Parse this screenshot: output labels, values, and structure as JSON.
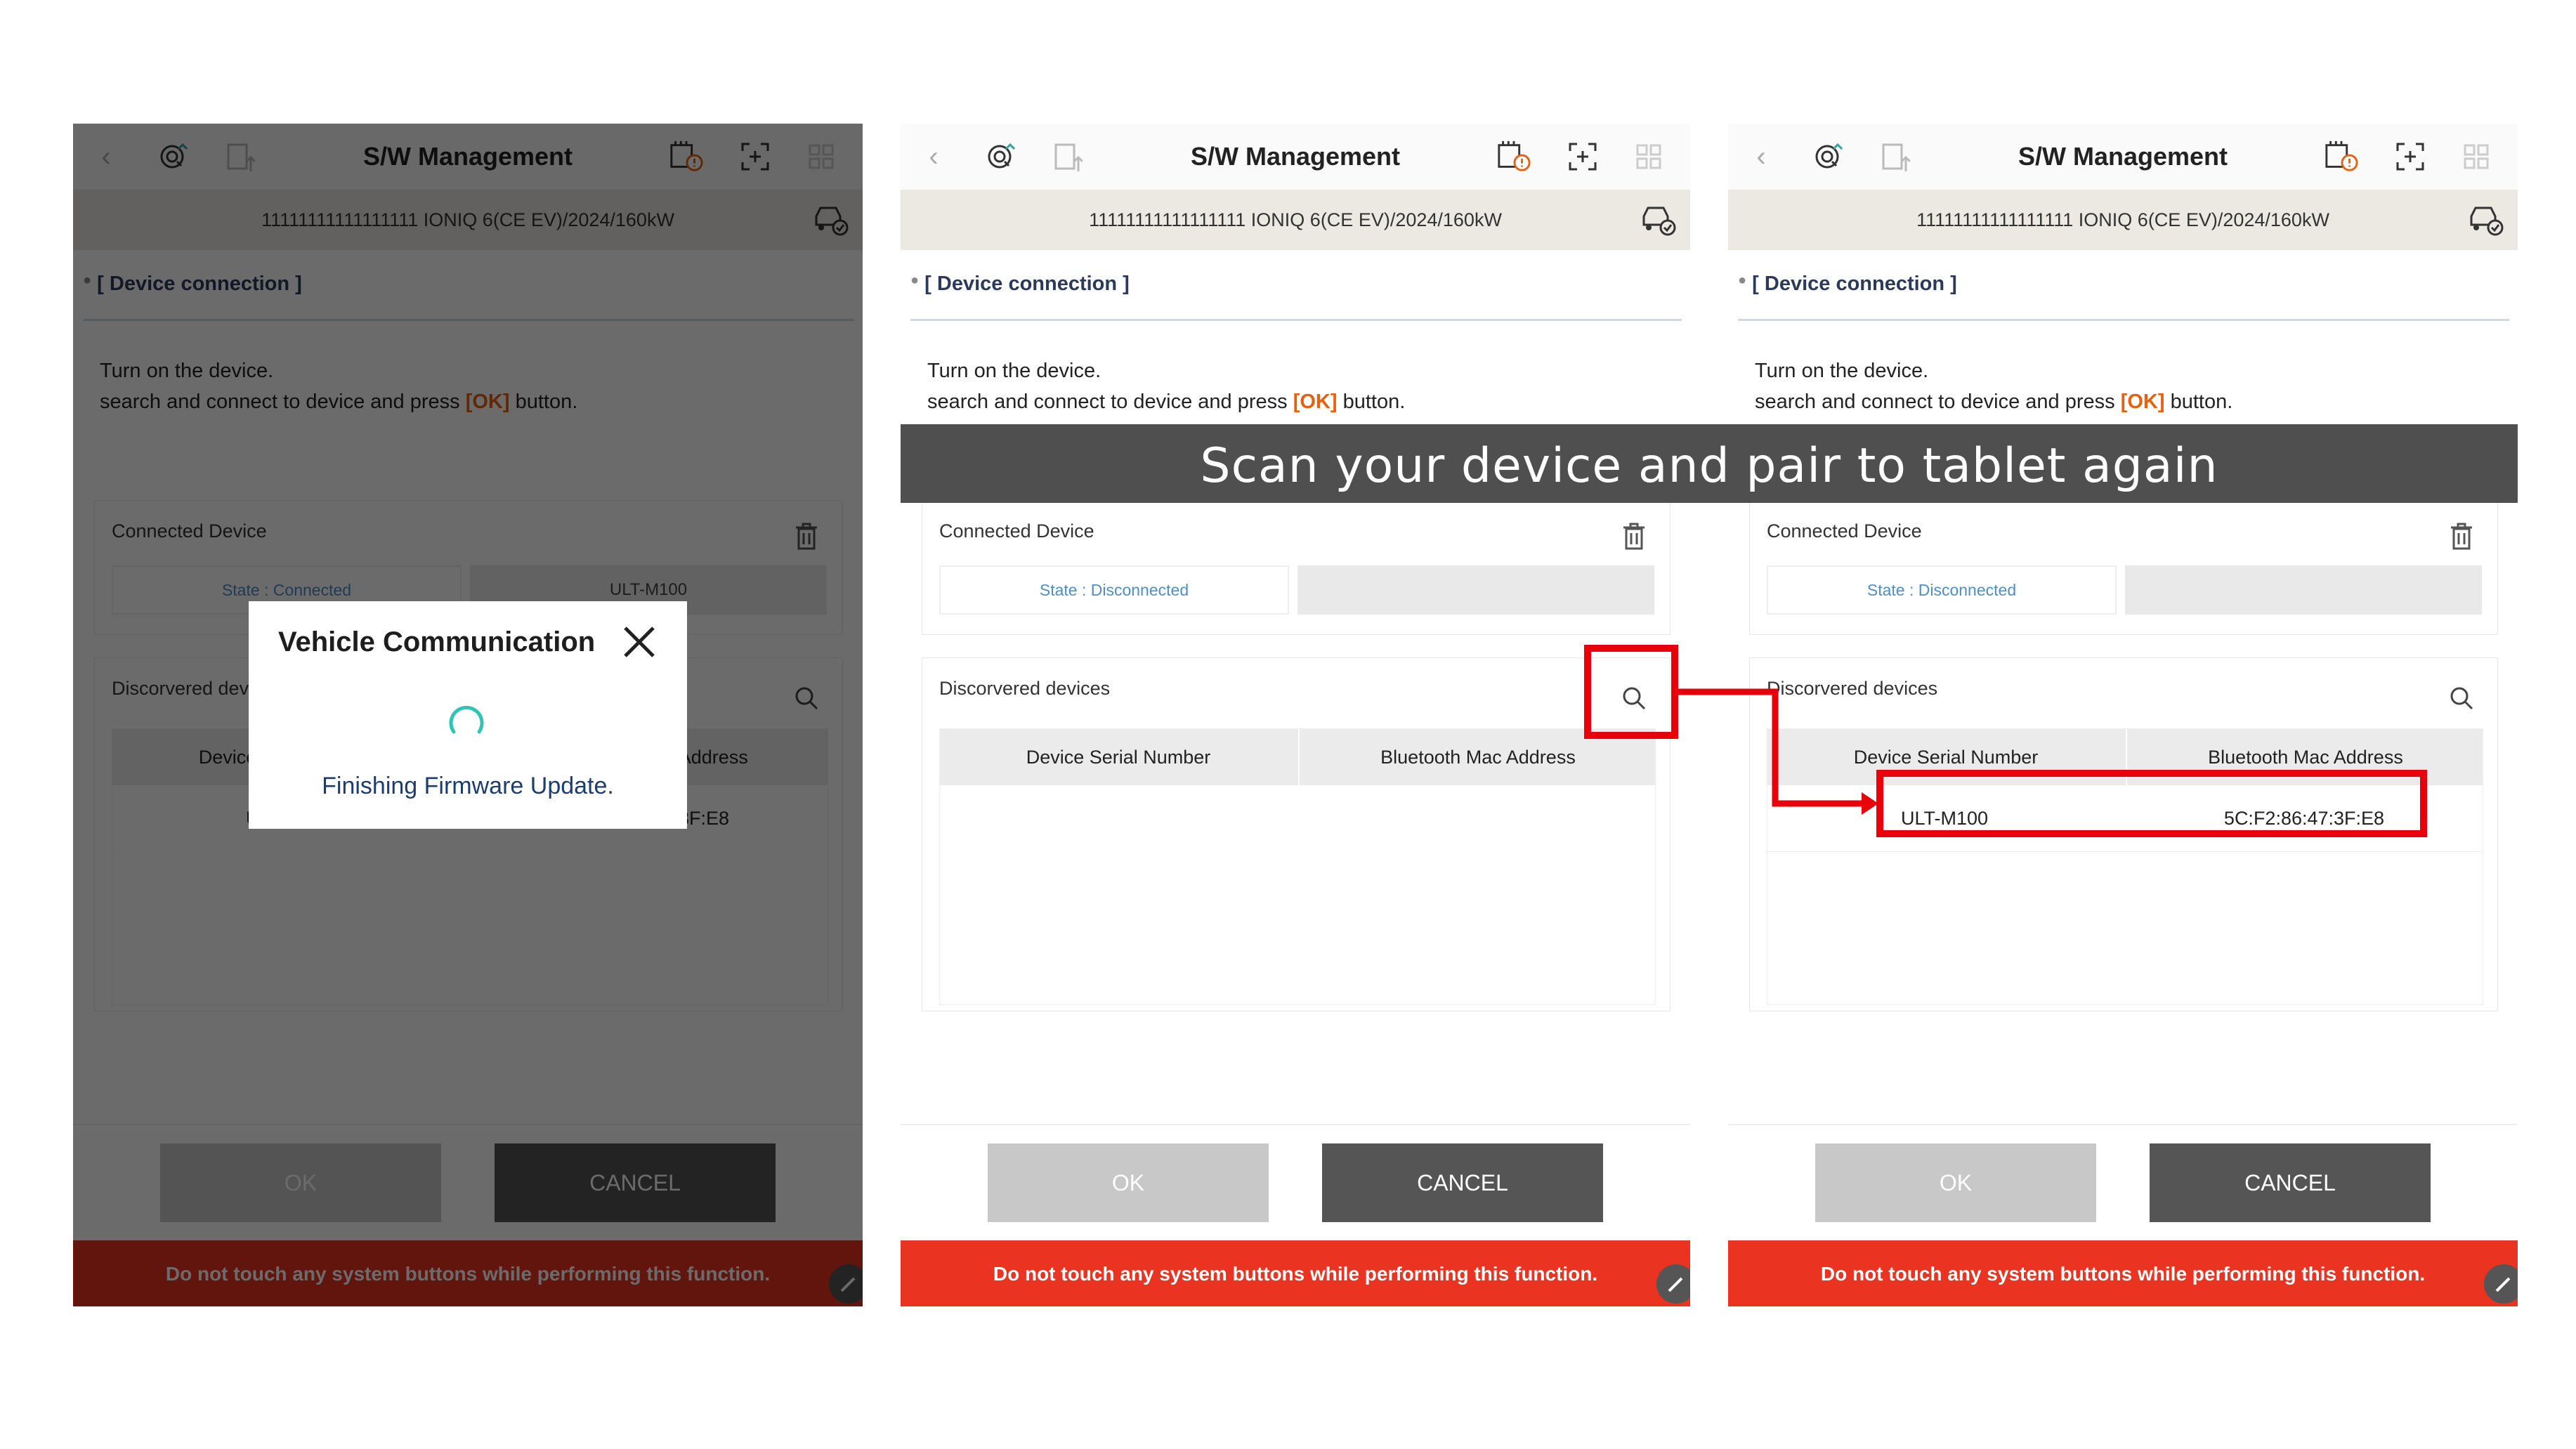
{
  "panels": [
    {
      "title": "S/W Management",
      "vehicle": "11111111111111111  IONIQ 6(CE EV)/2024/160kW",
      "section": "[ Device connection ]",
      "instructions": {
        "line1": "Turn on the device.",
        "line2_pre": "search and connect to device and press ",
        "line2_ok": "[OK]",
        "line2_post": " button."
      },
      "connected": {
        "label": "Connected Device",
        "state": "State : Connected",
        "device": "ULT-M100"
      },
      "discovered": {
        "label": "Discorvered devices",
        "columns": [
          "Device Serial Number",
          "Bluetooth Mac Address"
        ],
        "rows": [
          {
            "serial": "ULT-M100",
            "mac": "5C:F2:86:47:3F:E8"
          }
        ]
      },
      "buttons": {
        "ok": "OK",
        "cancel": "CANCEL"
      },
      "warning": "Do not touch any system buttons while performing this function.",
      "dialog": {
        "title": "Vehicle Communication",
        "message": "Finishing Firmware Update."
      }
    },
    {
      "title": "S/W Management",
      "vehicle": "11111111111111111  IONIQ 6(CE EV)/2024/160kW",
      "section": "[ Device connection ]",
      "instructions": {
        "line1": "Turn on the device.",
        "line2_pre": "search and connect to device and press ",
        "line2_ok": "[OK]",
        "line2_post": " button."
      },
      "connected": {
        "label": "Connected Device",
        "state": "State : Disconnected",
        "device": ""
      },
      "discovered": {
        "label": "Discorvered devices",
        "columns": [
          "Device Serial Number",
          "Bluetooth Mac Address"
        ],
        "rows": []
      },
      "buttons": {
        "ok": "OK",
        "cancel": "CANCEL"
      },
      "warning": "Do not touch any system buttons while performing this function."
    },
    {
      "title": "S/W Management",
      "vehicle": "11111111111111111  IONIQ 6(CE EV)/2024/160kW",
      "section": "[ Device connection ]",
      "instructions": {
        "line1": "Turn on the device.",
        "line2_pre": "search and connect to device and press ",
        "line2_ok": "[OK]",
        "line2_post": " button."
      },
      "connected": {
        "label": "Connected Device",
        "state": "State : Disconnected",
        "device": ""
      },
      "discovered": {
        "label": "Discorvered devices",
        "columns": [
          "Device Serial Number",
          "Bluetooth Mac Address"
        ],
        "rows": [
          {
            "serial": "ULT-M100",
            "mac": "5C:F2:86:47:3F:E8"
          }
        ]
      },
      "buttons": {
        "ok": "OK",
        "cancel": "CANCEL"
      },
      "warning": "Do not touch any system buttons while performing this function."
    }
  ],
  "banner": "Scan your device and pair to tablet again",
  "colors": {
    "warning_bar": "#ea3320",
    "highlight": "#e8000b",
    "ok_bracket": "#e8600c",
    "state_text": "#4d8fc8",
    "banner_bg": "#4f4f4f"
  }
}
